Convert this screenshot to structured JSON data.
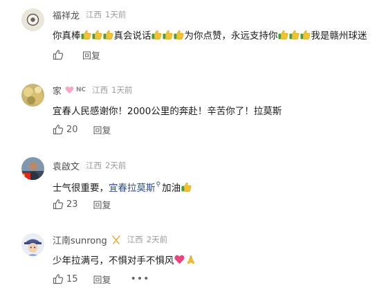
{
  "comments": [
    {
      "username": "福祥龙",
      "location": "江西",
      "time": "1天前",
      "text_parts": [
        "你真棒",
        "真会说话",
        "为你点赞，永远支持你",
        "我是赣州球迷"
      ],
      "likes": "",
      "reply_label": "回复"
    },
    {
      "username": "家",
      "badge": "NC",
      "location": "江西",
      "time": "1天前",
      "text": "宜春人民感谢你！2000公里的奔赴！辛苦你了！拉莫斯",
      "likes": "20",
      "reply_label": "回复"
    },
    {
      "username": "袁啟文",
      "location": "江西",
      "time": "2天前",
      "text_before": "士气很重要，",
      "text_link": "宜春拉莫斯",
      "text_after": "加油",
      "likes": "23",
      "reply_label": "回复"
    },
    {
      "username": "江南sunrong",
      "location": "江西",
      "time": "2天前",
      "text": "少年拉满弓，不惧对手不惧风",
      "likes": "15",
      "reply_label": "回复",
      "more_label": "•••"
    }
  ]
}
